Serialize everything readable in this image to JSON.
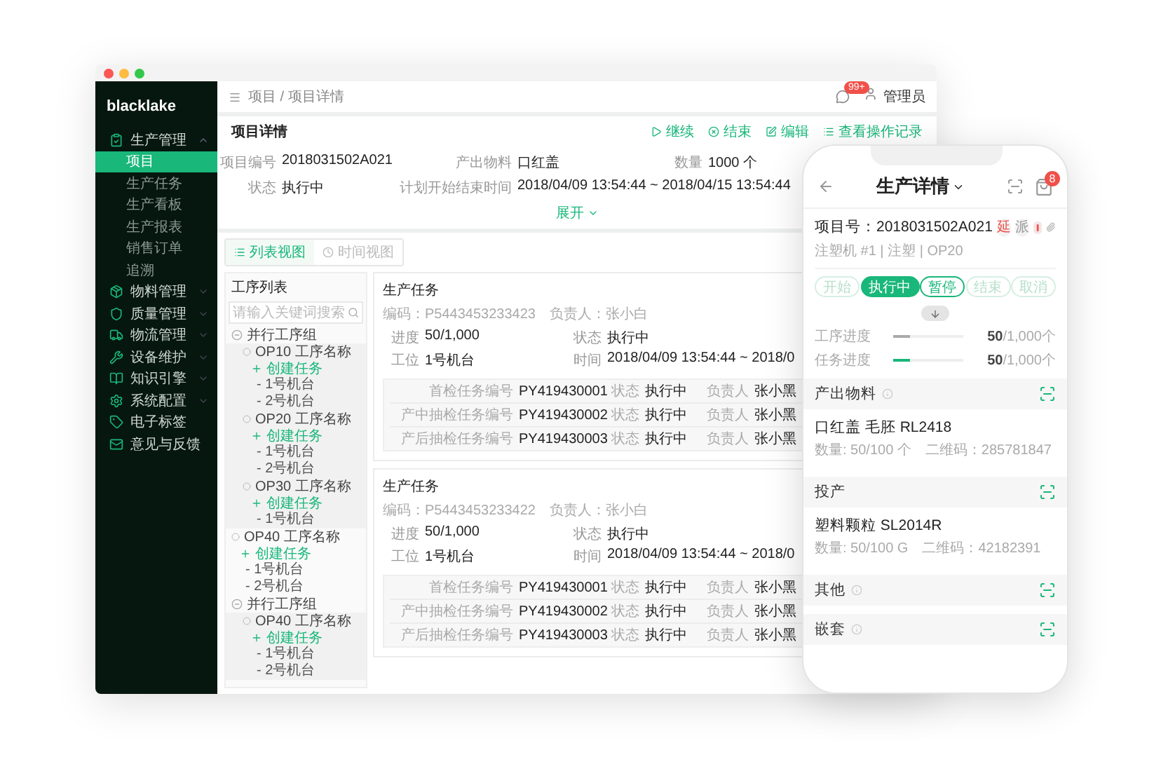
{
  "sidebar": {
    "logo": "blacklake",
    "items": [
      {
        "label": "生产管理",
        "expanded": true,
        "children": [
          {
            "label": "项目",
            "selected": true
          },
          {
            "label": "生产任务",
            "selected": false
          },
          {
            "label": "生产看板",
            "selected": false
          },
          {
            "label": "生产报表",
            "selected": false
          },
          {
            "label": "销售订单",
            "selected": false
          },
          {
            "label": "追溯",
            "selected": false
          }
        ]
      },
      {
        "label": "物料管理",
        "expanded": false
      },
      {
        "label": "质量管理",
        "expanded": false
      },
      {
        "label": "物流管理",
        "expanded": false
      },
      {
        "label": "设备维护",
        "expanded": false
      },
      {
        "label": "知识引擎",
        "expanded": false
      },
      {
        "label": "系统配置",
        "expanded": false
      },
      {
        "label": "电子标签"
      },
      {
        "label": "意见与反馈"
      }
    ]
  },
  "topbar": {
    "breadcrumb": "项目 / 项目详情",
    "badge": "99+",
    "user": "管理员"
  },
  "detail": {
    "title": "项目详情",
    "actions": [
      "继续",
      "结束",
      "编辑",
      "查看操作记录"
    ],
    "fields": [
      {
        "label": "项目编号",
        "value": "2018031502A021"
      },
      {
        "label": "产出物料",
        "value": "口红盖"
      },
      {
        "label": "数量",
        "value": "1000 个"
      },
      {
        "label": "状态",
        "value": "执行中"
      },
      {
        "label": "计划开始结束时间",
        "value": "2018/04/09 13:54:44 ~ 2018/04/15 13:54:44"
      }
    ],
    "expand": "展开"
  },
  "view_tabs": [
    {
      "label": "列表视图",
      "selected": true
    },
    {
      "label": "时间视图",
      "selected": false
    }
  ],
  "process_list": {
    "title": "工序列表",
    "placeholder": "请输入关键词搜索",
    "items": [
      {
        "kind": "group",
        "label": "并行工序组",
        "children": [
          {
            "kind": "process",
            "label": "OP10 工序名称",
            "action": "创建任务",
            "machines": [
              "- 1号机台",
              "- 2号机台"
            ]
          },
          {
            "kind": "process",
            "label": "OP20 工序名称",
            "action": "创建任务",
            "machines": [
              "- 1号机台",
              "- 2号机台"
            ]
          },
          {
            "kind": "process",
            "label": "OP30 工序名称",
            "action": "创建任务",
            "machines": [
              "- 1号机台"
            ]
          }
        ]
      },
      {
        "kind": "process",
        "label": "OP40 工序名称",
        "action": "创建任务",
        "machines": [
          "- 1号机台",
          "- 2号机台"
        ]
      },
      {
        "kind": "group",
        "label": "并行工序组",
        "children": [
          {
            "kind": "process",
            "label": "OP40 工序名称",
            "action": "创建任务",
            "machines": [
              "- 1号机台",
              "- 2号机台"
            ]
          }
        ]
      }
    ]
  },
  "tasks": [
    {
      "title": "生产任务",
      "code": "编码：P5443453233423",
      "owner": "负责人：张小白",
      "fields": [
        {
          "label": "进度",
          "value": "50/1,000"
        },
        {
          "label": "状态",
          "value": "执行中"
        },
        {
          "label": "工位",
          "value": "1号机台"
        },
        {
          "label": "时间",
          "value": "2018/04/09 13:54:44 ~ 2018/0"
        }
      ],
      "checks": [
        {
          "label": "首检任务编号",
          "code": "PY419430001",
          "status_label": "状态",
          "status": "执行中",
          "owner_label": "负责人",
          "owner": "张小黑"
        },
        {
          "label": "产中抽检任务编号",
          "code": "PY419430002",
          "status_label": "状态",
          "status": "执行中",
          "owner_label": "负责人",
          "owner": "张小黑"
        },
        {
          "label": "产后抽检任务编号",
          "code": "PY419430003",
          "status_label": "状态",
          "status": "执行中",
          "owner_label": "负责人",
          "owner": "张小黑"
        }
      ]
    },
    {
      "title": "生产任务",
      "code": "编码：P5443453233422",
      "owner": "负责人：张小白",
      "fields": [
        {
          "label": "进度",
          "value": "50/1,000"
        },
        {
          "label": "状态",
          "value": "执行中"
        },
        {
          "label": "工位",
          "value": "1号机台"
        },
        {
          "label": "时间",
          "value": "2018/04/09 13:54:44 ~ 2018/0"
        }
      ],
      "checks": [
        {
          "label": "首检任务编号",
          "code": "PY419430001",
          "status_label": "状态",
          "status": "执行中",
          "owner_label": "负责人",
          "owner": "张小黑"
        },
        {
          "label": "产中抽检任务编号",
          "code": "PY419430002",
          "status_label": "状态",
          "status": "执行中",
          "owner_label": "负责人",
          "owner": "张小黑"
        },
        {
          "label": "产后抽检任务编号",
          "code": "PY419430003",
          "status_label": "状态",
          "status": "执行中",
          "owner_label": "负责人",
          "owner": "张小黑"
        }
      ]
    }
  ],
  "phone": {
    "title": "生产详情",
    "badge": "8",
    "project": "项目号：2018031502A021",
    "tags": [
      {
        "text": "延",
        "color": "#f0504a"
      },
      {
        "text": "派",
        "color": "#999999"
      }
    ],
    "subtitle": "注塑机 #1 | 注塑 | OP20",
    "statuses": [
      {
        "label": "开始",
        "selected": false,
        "disabled": true
      },
      {
        "label": "执行中",
        "selected": true,
        "disabled": false
      },
      {
        "label": "暂停",
        "selected": false,
        "disabled": false
      },
      {
        "label": "结束",
        "selected": false,
        "disabled": true
      },
      {
        "label": "取消",
        "selected": false,
        "disabled": true
      }
    ],
    "progress": [
      {
        "label": "工序进度",
        "level": 0.23,
        "color": "#aaaaaa",
        "reading": "**50**/1,000个"
      },
      {
        "label": "任务进度",
        "level": 0.23,
        "color": "#19b77a",
        "reading": "**50**/1,000个"
      }
    ],
    "sections": [
      {
        "title": "产出物料",
        "info": true,
        "items": [
          {
            "name": "口红盖 毛胚 RL2418",
            "qty": "数量: 50/100 个",
            "code": "二维码：285781847"
          }
        ]
      },
      {
        "title": "投产",
        "info": false,
        "items": [
          {
            "name": "塑料颗粒 SL2014R",
            "qty": "数量: 50/100 G",
            "code": "二维码：42182391"
          }
        ]
      },
      {
        "title": "其他",
        "info": true
      },
      {
        "title": "嵌套",
        "info": true
      }
    ]
  }
}
